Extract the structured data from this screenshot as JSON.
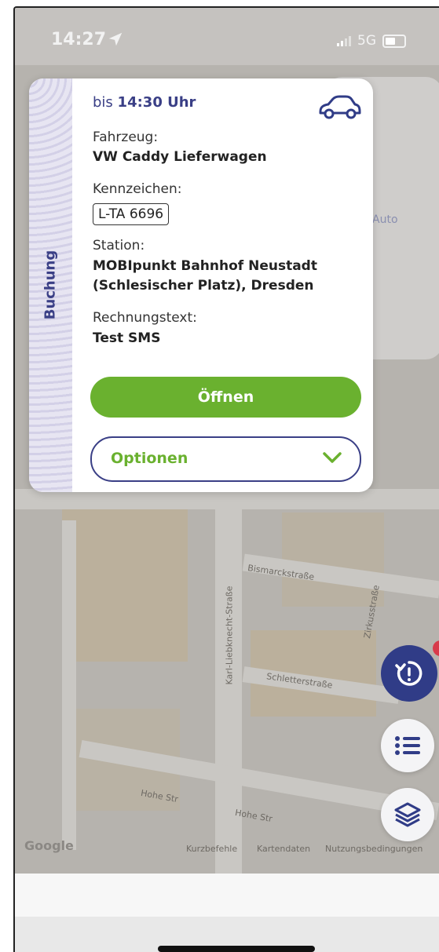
{
  "status_bar": {
    "time": "14:27",
    "network": "5G"
  },
  "map": {
    "street_labels": [
      "Bismarckstraße",
      "Karl-Liebknecht-Straße",
      "Schletterstraße",
      "Hohe Str",
      "Hohe Str",
      "Zirkusstraße"
    ],
    "attribution": [
      "Kurzbefehle",
      "Kartendaten",
      "Nutzungsbedingungen"
    ],
    "logo": "Google"
  },
  "background_panel": {
    "auto_label": "Auto"
  },
  "booking_card": {
    "tab_label": "Buchung",
    "until_prefix": "bis",
    "until_time": "14:30 Uhr",
    "vehicle_label": "Fahrzeug:",
    "vehicle_value": "VW Caddy Lieferwagen",
    "plate_label": "Kennzeichen:",
    "plate_value": "L-TA 6696",
    "station_label": "Station:",
    "station_line1": "MOBIpunkt Bahnhof Neustadt",
    "station_line2": "(Schlesischer Platz), Dresden",
    "invoice_label": "Rechnungstext:",
    "invoice_value": "Test SMS",
    "open_button": "Öffnen",
    "options_button": "Optionen"
  },
  "colors": {
    "primary_blue": "#303c87",
    "accent_green": "#6ab12f",
    "card_bg": "#ffffff",
    "tab_bg": "#e7e5f2",
    "badge_red": "#d83a4a"
  },
  "icons": [
    "location-arrow-icon",
    "signal-icon",
    "battery-icon",
    "car-icon",
    "chevron-down-icon",
    "timer-icon",
    "list-icon",
    "layers-icon"
  ]
}
